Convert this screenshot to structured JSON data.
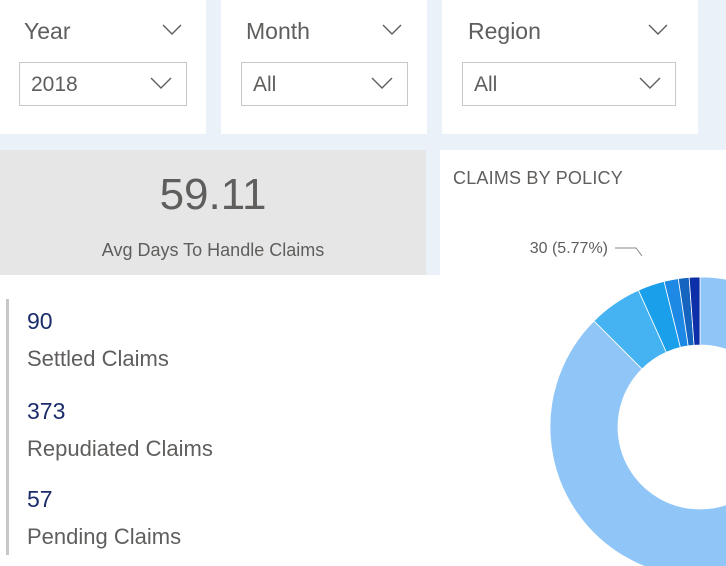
{
  "slicers": [
    {
      "title": "Year",
      "value": "2018"
    },
    {
      "title": "Month",
      "value": "All"
    },
    {
      "title": "Region",
      "value": "All"
    }
  ],
  "card": {
    "value": "59.11",
    "label": "Avg Days To Handle Claims"
  },
  "kpis": [
    {
      "value": "90",
      "label": "Settled Claims"
    },
    {
      "value": "373",
      "label": "Repudiated Claims"
    },
    {
      "value": "57",
      "label": "Pending Claims"
    }
  ],
  "icons": {
    "dropdown": "chevron-down-icon"
  },
  "colors": {
    "kpi_value": "#1b2c6b",
    "slice_main": "#8fc5f7",
    "slice_2": "#45b3f2",
    "slice_3": "#1aa0ea",
    "slice_4": "#1e88e5",
    "slice_5": "#1565c0",
    "slice_6": "#0d2fa8"
  },
  "chart_data": {
    "type": "pie",
    "title": "CLAIMS BY POLICY",
    "categories": [
      "",
      "",
      "",
      "",
      "",
      ""
    ],
    "values": [
      455,
      30,
      15,
      8,
      6,
      6
    ],
    "data_labels": [
      "",
      "30 (5.77%)",
      "",
      "",
      "",
      ""
    ],
    "donut": true
  }
}
